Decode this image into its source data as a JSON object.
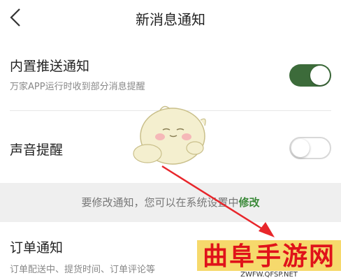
{
  "header": {
    "title": "新消息通知",
    "back_icon": "chevron-left-icon"
  },
  "settings": {
    "builtin_push": {
      "title": "内置推送通知",
      "subtitle": "万家APP运行时收到部分消息提醒",
      "enabled": true
    },
    "sound_alert": {
      "title": "声音提醒",
      "enabled": false
    }
  },
  "notice": {
    "text": "要修改通知，您可以在系统设置中",
    "link": "修改"
  },
  "orders": {
    "title": "订单通知",
    "subtitle": "订单配送中、提货时间、订单评论等"
  },
  "watermark": {
    "title": "曲阜手游网",
    "url": "ZWFW.QFSP.NET"
  },
  "colors": {
    "toggle_on": "#3c6b3a",
    "link": "#3c8a3a",
    "arrow": "#e8262b"
  }
}
